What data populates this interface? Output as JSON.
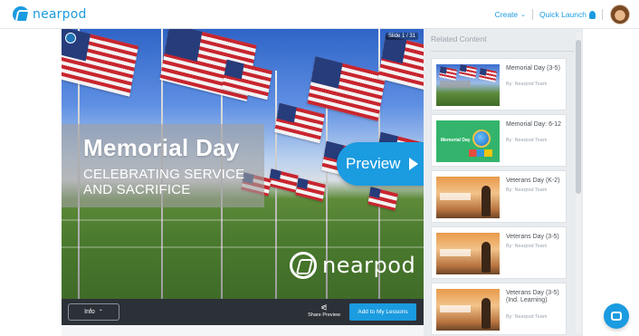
{
  "header": {
    "logo_text": "nearpod",
    "create_label": "Create",
    "quick_launch_label": "Quick Launch"
  },
  "lesson": {
    "title": "Memorial Day",
    "subtitle": "CELEBRATING SERVICE AND SACRIFICE",
    "preview_label": "Preview",
    "slide_counter": "Slide 1 / 31",
    "watermark_text": "nearpod",
    "info_label": "Info",
    "share_label": "Share Preview",
    "add_label": "Add to My Lessons"
  },
  "related": {
    "header": "Related Content",
    "items": [
      {
        "title": "Memorial Day (3-5)",
        "author": "By: Nearpod Team",
        "thumb": "flags"
      },
      {
        "title": "Memorial Day: 6-12",
        "author": "By: Nearpod Team",
        "thumb": "green",
        "thumb_label": "Memorial Day"
      },
      {
        "title": "Veterans Day (K-2)",
        "author": "By: Nearpod Team",
        "thumb": "salute"
      },
      {
        "title": "Veterans Day (3-5)",
        "author": "By: Nearpod Team",
        "thumb": "salute"
      },
      {
        "title": "Veterans Day (3-5) (Ind. Learning)",
        "author": "By: Nearpod Team",
        "thumb": "salute"
      }
    ]
  },
  "colors": {
    "brand_blue": "#1b9be0",
    "bar_dark": "#2c3138",
    "panel_gray": "#e9ecef"
  }
}
